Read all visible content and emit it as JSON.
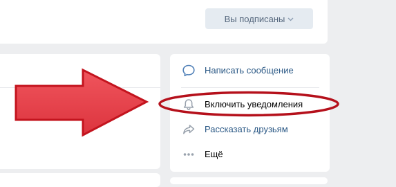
{
  "header": {
    "subscribe_button_label": "Вы подписаны",
    "subscribe_dropdown_icon": "chevron-down-icon"
  },
  "actions_menu": {
    "items": [
      {
        "label": "Написать сообщение",
        "icon": "chat-bubble-icon"
      },
      {
        "label": "Включить уведомления",
        "icon": "bell-icon"
      },
      {
        "label": "Рассказать друзьям",
        "icon": "share-arrow-icon"
      },
      {
        "label": "Ещё",
        "icon": "more-dots-icon"
      }
    ]
  },
  "annotation": {
    "arrow_color": "#e3404a",
    "arrow_stroke": "#c3141e",
    "ellipse_color": "#b5101b"
  },
  "colors": {
    "page_background": "#edeef0",
    "card_background": "#ffffff",
    "link_blue": "#2a5885",
    "button_background": "#e5ebf1",
    "icon_blue": "#5181b8"
  }
}
